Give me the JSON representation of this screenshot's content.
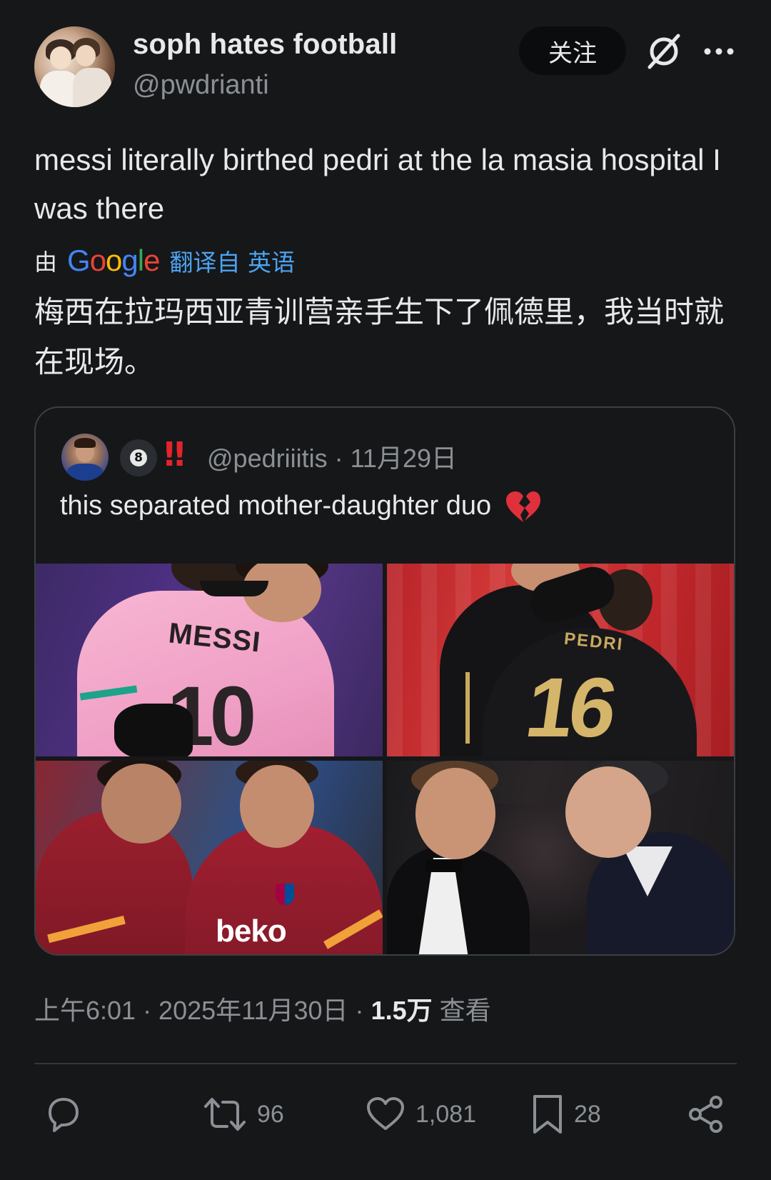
{
  "author": {
    "display_name": "soph hates football",
    "handle": "@pwdrianti",
    "follow_label": "关注"
  },
  "tweet": {
    "text": "messi literally birthed pedri at the la masia hospital I was there",
    "translation_by": "由",
    "translation_brand": "Google",
    "translation_link": "翻译自 英语",
    "translated_text": "梅西在拉玛西亚青训营亲手生下了佩德里，我当时就在现场。"
  },
  "quote": {
    "badge_number": "8",
    "badge_bang": "‼",
    "handle_date": "@pedriiitis · 11月29日",
    "text": "this separated mother-daughter duo",
    "photo1_name": "MESSI",
    "photo1_number": "10",
    "photo2_name": "PEDRI",
    "photo2_number": "16",
    "photo3_sponsor": "beko"
  },
  "meta": {
    "time_date": "上午6:01 · 2025年11月30日 · ",
    "views": "1.5万",
    "views_label": " 查看"
  },
  "actions": {
    "reply_count": "",
    "retweet_count": "96",
    "like_count": "1,081",
    "bookmark_count": "28"
  },
  "icons": {
    "avatar": "user-avatar",
    "grok": "grok-icon",
    "more": "more-dots-icon",
    "reply": "reply-icon",
    "retweet": "retweet-icon",
    "like": "heart-icon",
    "bookmark": "bookmark-icon",
    "share": "share-icon",
    "broken_heart": "broken-heart-emoji"
  },
  "colors": {
    "background": "#161719",
    "text": "#e7e9ea",
    "muted": "#8b9095",
    "link": "#4aa3f0",
    "border": "#3b3f44"
  }
}
